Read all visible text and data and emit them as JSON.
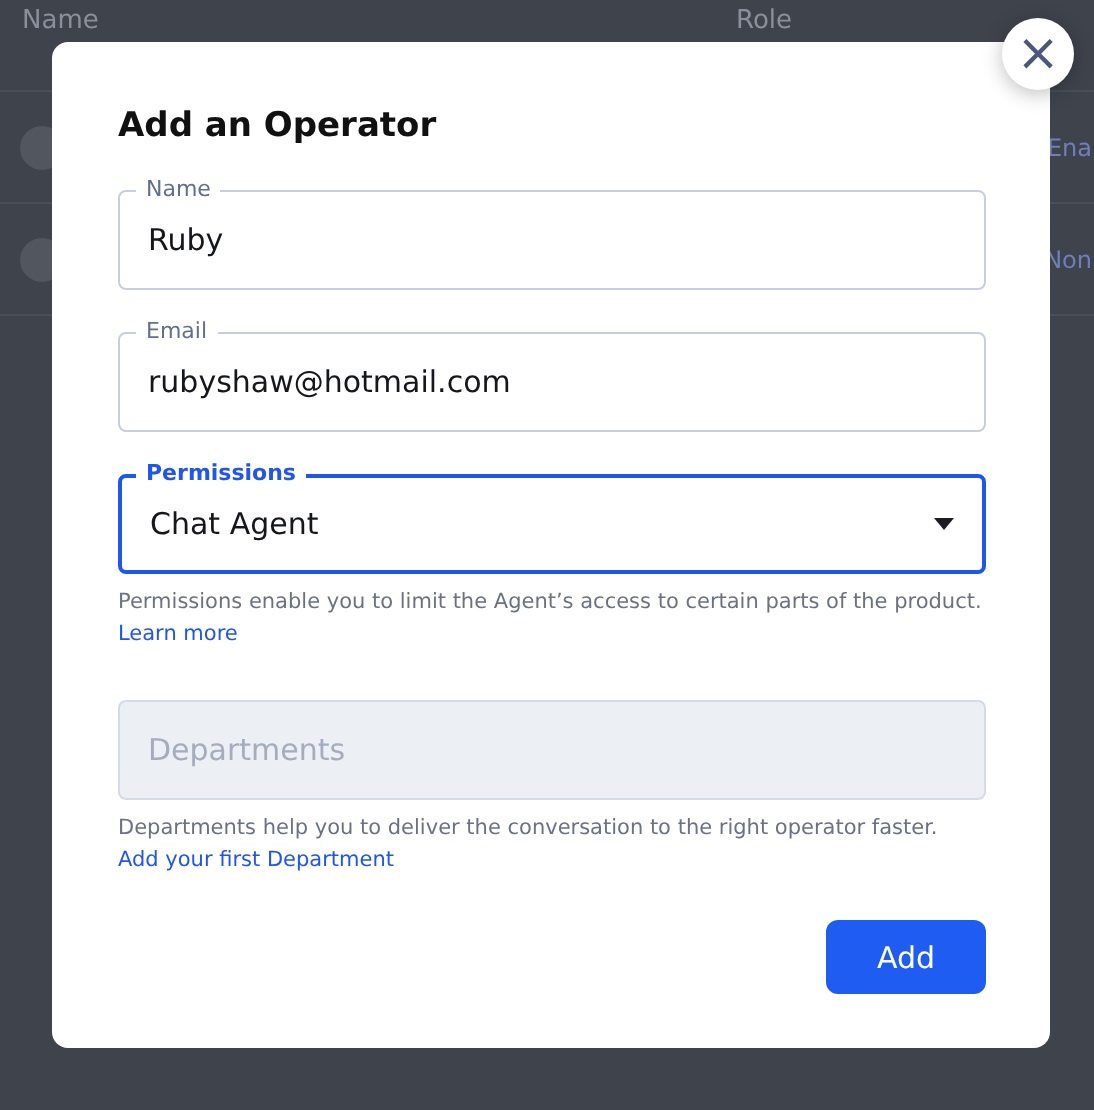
{
  "background_table": {
    "columns": [
      "Name",
      "Role"
    ],
    "rows": [
      {
        "column_3": "Ena"
      },
      {
        "column_3": "Non"
      }
    ]
  },
  "dialog": {
    "title": "Add an Operator",
    "close_label": "×",
    "fields": [
      {
        "kind": "text",
        "label": "Name",
        "value": "Ruby",
        "focused": false
      },
      {
        "kind": "text",
        "label": "Email",
        "value": "rubyshaw@hotmail.com",
        "focused": false
      },
      {
        "kind": "select",
        "label": "Permissions",
        "value": "Chat Agent",
        "focused": true,
        "help": "Permissions enable you to limit the Agent’s access to certain parts of the product.",
        "help_link": "Learn more"
      },
      {
        "kind": "disabled",
        "placeholder": "Departments",
        "help": "Departments help you to deliver the conversation to the right operator faster.",
        "help_link": "Add your first Department"
      }
    ],
    "submit": "Add"
  }
}
